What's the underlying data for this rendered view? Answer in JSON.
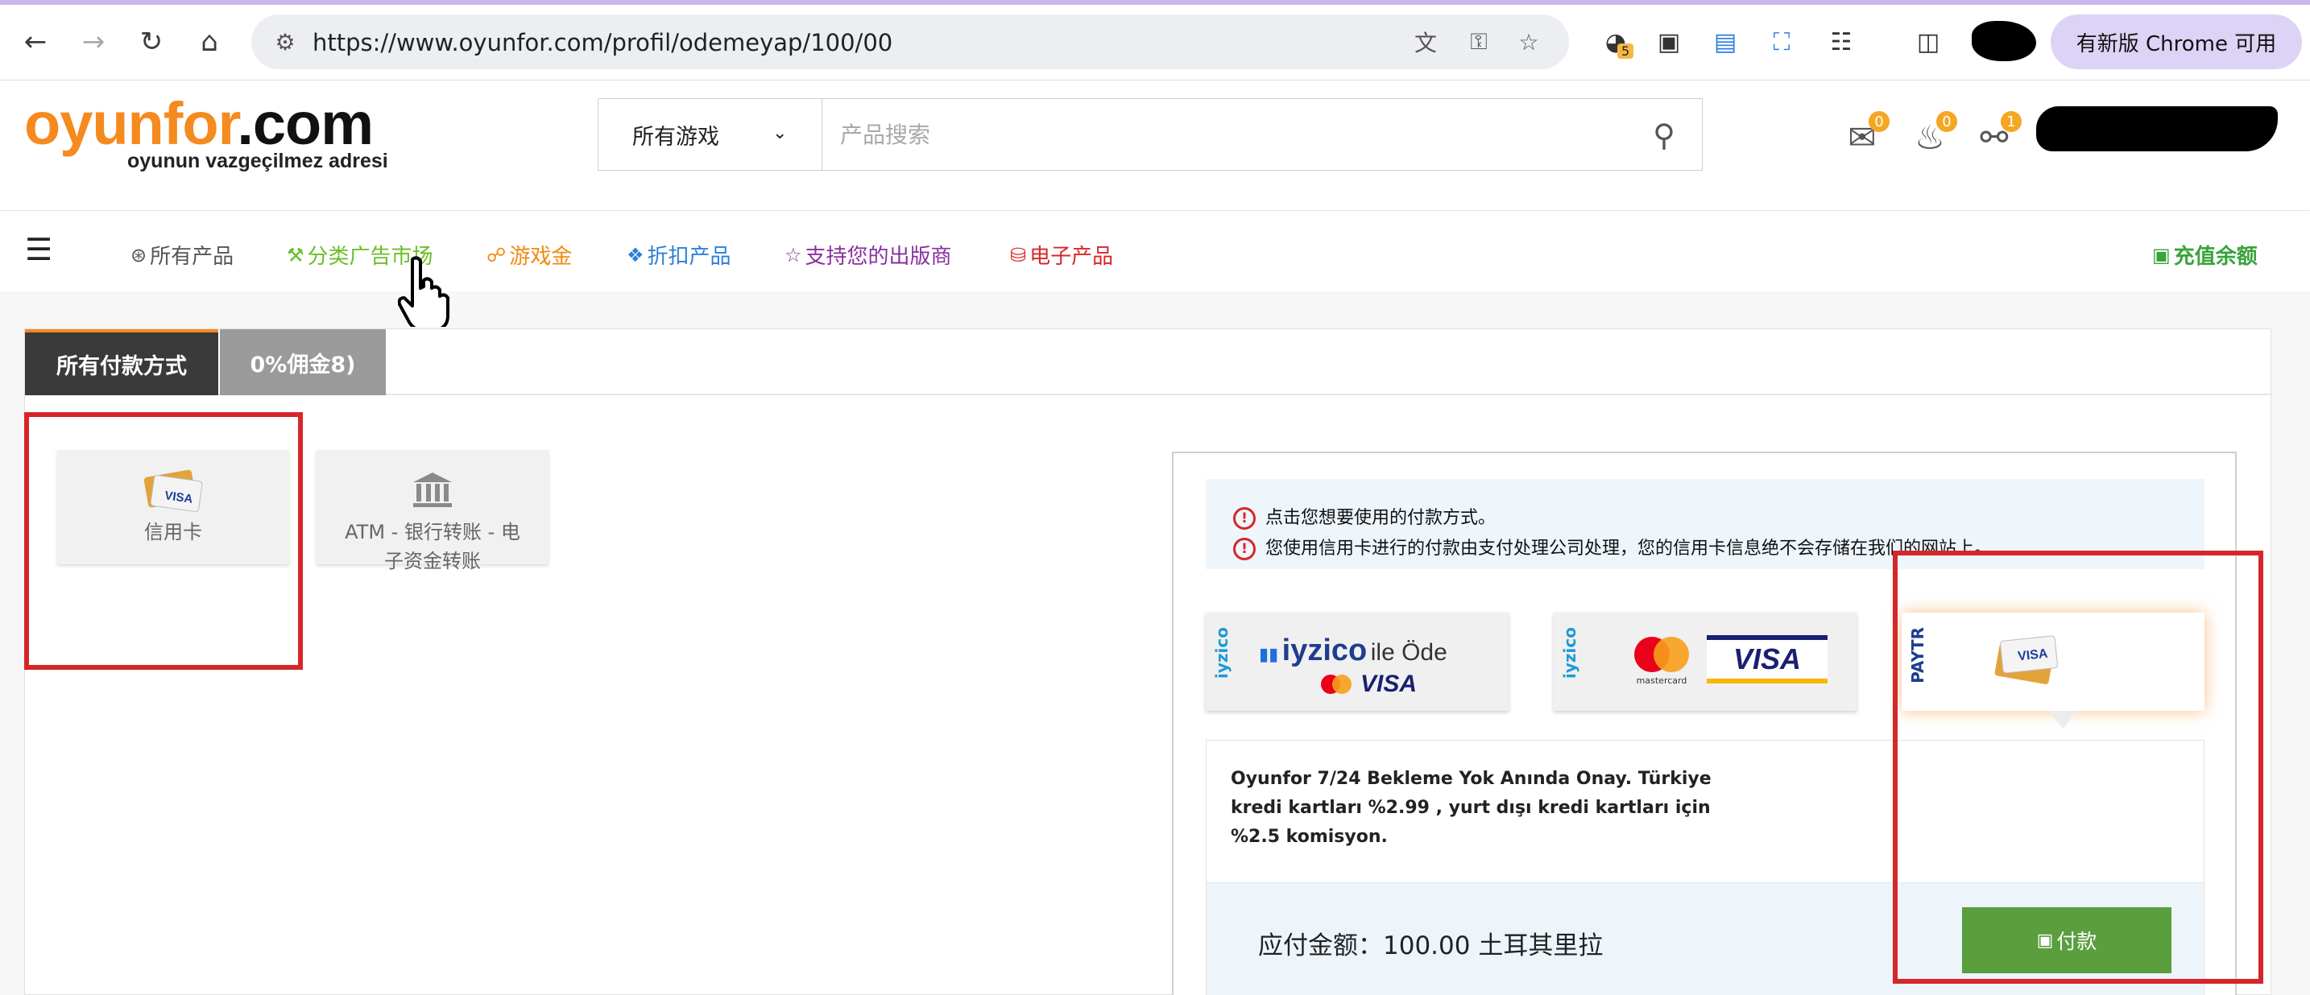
{
  "browser": {
    "url": "https://www.oyunfor.com/profil/odemeyap/100/00",
    "extension_badge": "5",
    "update_chip": "有新版 Chrome 可用"
  },
  "site": {
    "logo_main_orange": "oyunfor",
    "logo_main_dark": ".com",
    "logo_tagline": "oyunun vazgeçilmez adresi",
    "game_select": "所有游戏",
    "search_placeholder": "产品搜索",
    "messages_count": "0",
    "notifications_count": "0",
    "cart_count": "1"
  },
  "nav": {
    "items": [
      {
        "label": "所有产品",
        "color": "#555555"
      },
      {
        "label": "分类广告市场",
        "color": "#6abf2a"
      },
      {
        "label": "游戏金",
        "color": "#f08a10"
      },
      {
        "label": "折扣产品",
        "color": "#2b7fd8"
      },
      {
        "label": "支持您的出版商",
        "color": "#8a2fa0"
      },
      {
        "label": "电子产品",
        "color": "#d8262a"
      }
    ],
    "balance": "充值余额",
    "balance_color": "#3aa33a"
  },
  "payment": {
    "tabs": [
      "所有付款方式",
      "0%佣金8)"
    ],
    "methods": [
      {
        "label": "信用卡",
        "icon": "credit-card-icon"
      },
      {
        "label": "ATM - 银行转账 - 电子资金转账",
        "icon": "bank-icon"
      }
    ],
    "info_lines": [
      "点击您想要使用的付款方式。",
      "您使用信用卡进行的付款由支付处理公司处理，您的信用卡信息绝不会存储在我们的网站上。"
    ],
    "providers": [
      {
        "tag": "iyzico",
        "main": "iyzico",
        "suffix": "ile Öde",
        "brand": "VISA"
      },
      {
        "tag": "iyzico",
        "card1": "mastercard",
        "brand": "VISA"
      },
      {
        "tag": "PAYTR",
        "brand": "VISA"
      }
    ],
    "description": "Oyunfor 7/24 Bekleme Yok Anında Onay. Türkiye kredi kartları %2.99 , yurt dışı kredi kartları için %2.5 komisyon.",
    "total": "应付金额：100.00 土耳其里拉",
    "pay_button": "付款"
  }
}
